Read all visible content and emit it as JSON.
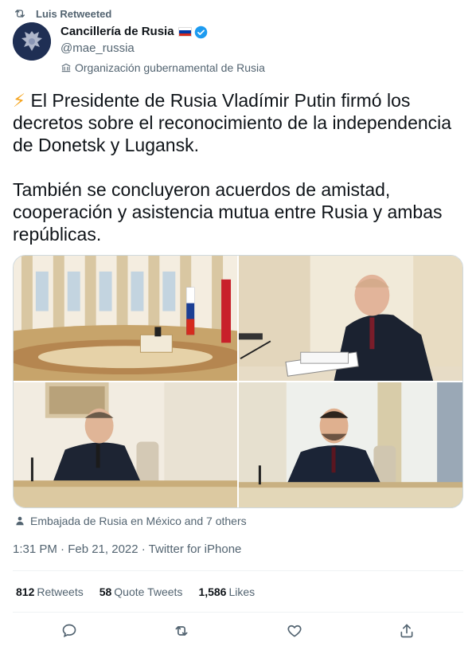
{
  "retweet": {
    "label": "Luis Retweeted",
    "icon": "retweet-icon"
  },
  "author": {
    "name": "Cancillería de Rusia",
    "handle": "@mae_russia",
    "org_label": "Organización gubernamental de Rusia",
    "verified": true,
    "flag_colors": [
      "#ffffff",
      "#0039a6",
      "#d52b1e"
    ]
  },
  "tweet": {
    "emoji": "⚡",
    "text": " El Presidente de Rusia Vladímir Putin firmó los decretos sobre el reconocimiento de la independencia de Donetsk y Lugansk.\n\nTambién se concluyeron acuerdos de amistad, cooperación y asistencia mutua entre Rusia y ambas repúblicas."
  },
  "media": {
    "images": [
      "kremlin-hall-photo",
      "putin-signing-photo",
      "pasechnik-at-desk-photo",
      "pushilin-at-desk-photo"
    ]
  },
  "liked_by": "Embajada de Rusia en México and 7 others",
  "meta": "1:31 PM · Feb 21, 2022 · Twitter for iPhone",
  "stats": {
    "retweets_count": "812",
    "retweets_label": "Retweets",
    "quotes_count": "58",
    "quotes_label": "Quote Tweets",
    "likes_count": "1,586",
    "likes_label": "Likes"
  },
  "actions": [
    "reply-icon",
    "retweet-icon",
    "like-icon",
    "share-icon"
  ],
  "colors": {
    "accent": "#1d9bf0",
    "text": "#0f1419",
    "secondary": "#536471",
    "border": "#eff3f4"
  }
}
